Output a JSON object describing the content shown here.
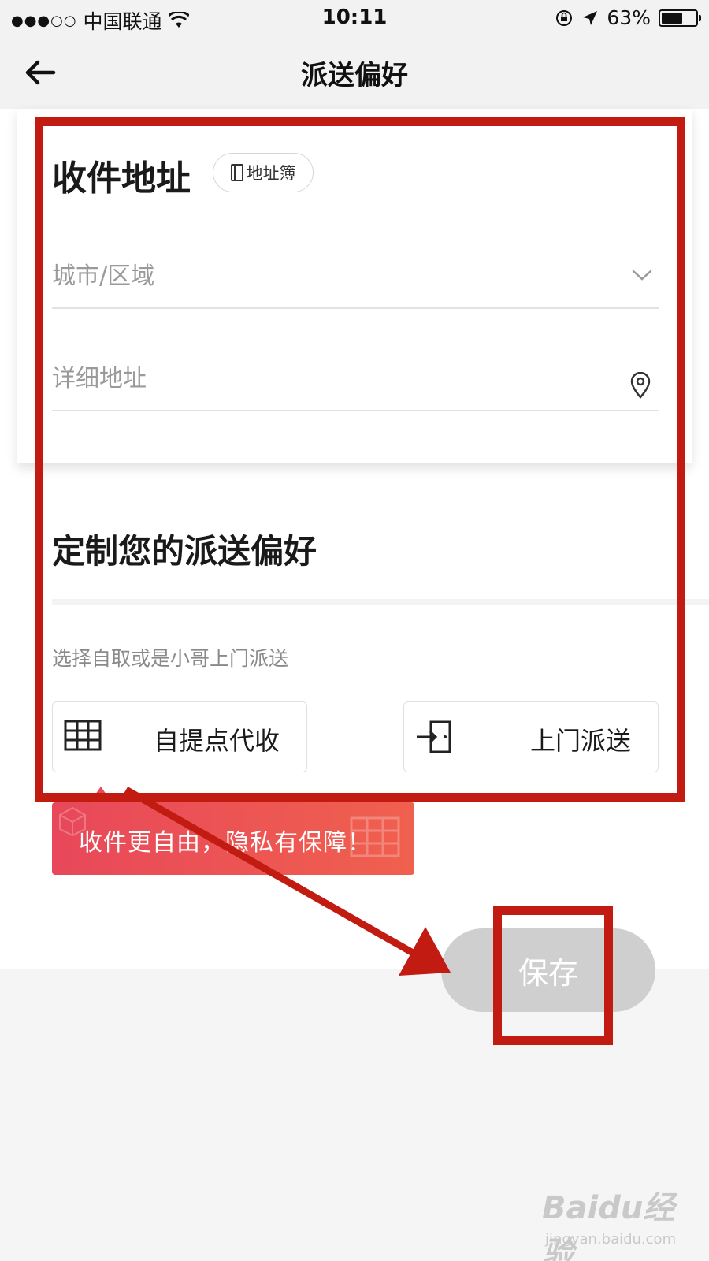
{
  "status_bar": {
    "signal": "●●●○○",
    "carrier": "中国联通",
    "time": "10:11",
    "battery_percent": "63%",
    "battery_level": 0.63
  },
  "nav": {
    "title": "派送偏好"
  },
  "address": {
    "title": "收件地址",
    "book_label": "地址簿",
    "city_placeholder": "城市/区域",
    "detail_placeholder": "详细地址"
  },
  "preference": {
    "title": "定制您的派送偏好",
    "subtitle": "选择自取或是小哥上门派送",
    "options": [
      {
        "label": "自提点代收",
        "icon": "grid-locker-icon"
      },
      {
        "label": "上门派送",
        "icon": "door-enter-icon"
      }
    ],
    "tooltip": "收件更自由，隐私有保障！"
  },
  "save_label": "保存",
  "watermark": {
    "brand": "Baidu经验",
    "url": "jingyan.baidu.com"
  },
  "colors": {
    "annotation": "#c21b12",
    "tooltip": "#e8485a",
    "save_disabled": "#cfcfcf"
  }
}
